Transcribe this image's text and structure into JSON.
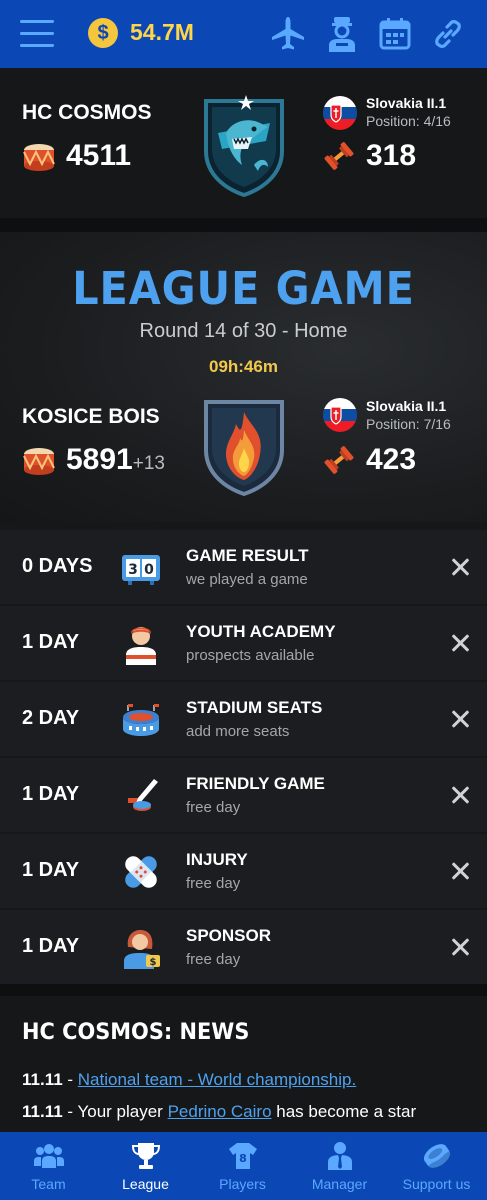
{
  "topbar": {
    "money": "54.7M",
    "icons": [
      "menu-icon",
      "coin-icon",
      "airplane-icon",
      "scout-icon",
      "calendar-icon",
      "link-icon"
    ]
  },
  "my_team": {
    "name": "HC COSMOS",
    "fans": "4511",
    "league": "Slovakia II.1",
    "position": "Position: 4/16",
    "strength": "318"
  },
  "league_game": {
    "title": "LEAGUE GAME",
    "round": "Round 14 of 30 - Home",
    "timer": "09h:46m",
    "opponent": {
      "name": "KOSICE BOIS",
      "fans": "5891",
      "fans_delta": "+13",
      "league": "Slovakia II.1",
      "position": "Position: 7/16",
      "strength": "423"
    }
  },
  "events": [
    {
      "days": "0 DAYS",
      "title": "GAME RESULT",
      "sub": "we played a game",
      "icon": "scoreboard-icon"
    },
    {
      "days": "1 DAY",
      "title": "YOUTH ACADEMY",
      "sub": "prospects available",
      "icon": "youth-player-icon"
    },
    {
      "days": "2 DAY",
      "title": "STADIUM SEATS",
      "sub": "add more seats",
      "icon": "stadium-icon"
    },
    {
      "days": "1 DAY",
      "title": "FRIENDLY GAME",
      "sub": "free day",
      "icon": "hockey-stick-icon"
    },
    {
      "days": "1 DAY",
      "title": "INJURY",
      "sub": "free day",
      "icon": "bandage-icon"
    },
    {
      "days": "1 DAY",
      "title": "SPONSOR",
      "sub": "free day",
      "icon": "sponsor-icon"
    }
  ],
  "news": {
    "title": "HC COSMOS: NEWS",
    "items": [
      {
        "date": "11.11",
        "sep": " - ",
        "link": "National team - World championship.",
        "rest": ""
      },
      {
        "date": "11.11",
        "sep": " - Your player ",
        "link": "Pedrino Cairo",
        "rest": " has become a star"
      }
    ]
  },
  "bottom_nav": [
    {
      "label": "Team",
      "icon": "team-icon"
    },
    {
      "label": "League",
      "icon": "trophy-icon",
      "active": true
    },
    {
      "label": "Players",
      "icon": "jersey-icon"
    },
    {
      "label": "Manager",
      "icon": "manager-icon"
    },
    {
      "label": "Support us",
      "icon": "puck-icon"
    }
  ],
  "colors": {
    "brand_blue": "#0b48b5",
    "accent_blue": "#4ea1ef",
    "gold": "#f2c94c"
  }
}
